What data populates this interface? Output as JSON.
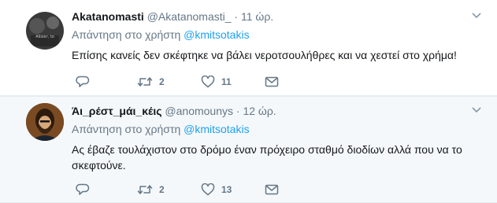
{
  "tweets": [
    {
      "fullname": "Akatanomasti",
      "username": "@Akatanomasti_",
      "separator": "·",
      "time": "11 ώρ.",
      "reply_prefix": "Απάντηση στο χρήστη",
      "reply_mention": "@kmitsotakis",
      "text": "Επίσης κανείς δεν σκέφτηκε να βάλει νεροτσουλήθρες και να χεστεί στο χρήμα!",
      "retweets": "2",
      "likes": "11",
      "avatar_text": "Alisier, to ..."
    },
    {
      "fullname": "Άι_ρέστ_μάι_κέις",
      "username": "@anomounys",
      "separator": "·",
      "time": "12 ώρ.",
      "reply_prefix": "Απάντηση στο χρήστη",
      "reply_mention": "@kmitsotakis",
      "text": "Ας έβαζε τουλάχιστον στο δρόμο έναν πρόχειρο σταθμό διοδίων αλλά που να το σκεφτούνε.",
      "retweets": "2",
      "likes": "13"
    }
  ],
  "colors": {
    "link": "#1da1f2",
    "secondary_text": "#657786",
    "background": "#e6ecf0"
  },
  "icons": [
    "reply-icon",
    "retweet-icon",
    "like-icon",
    "message-icon",
    "chevron-down-icon"
  ]
}
